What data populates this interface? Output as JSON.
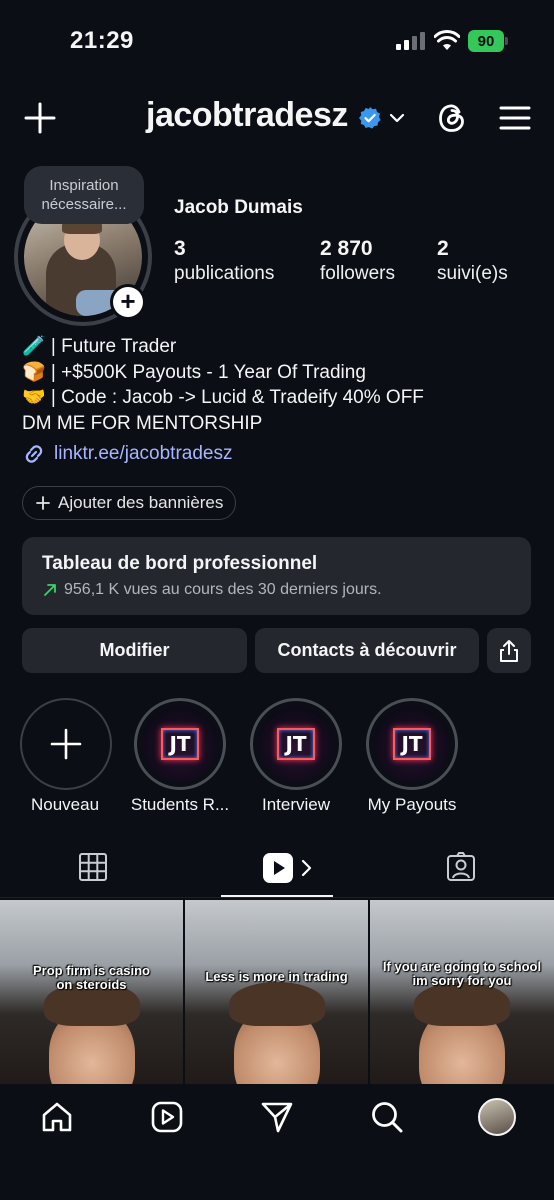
{
  "status": {
    "time": "21:29",
    "battery": "90"
  },
  "header": {
    "username": "jacobtradesz"
  },
  "profile": {
    "note": "Inspiration nécessaire...",
    "full_name": "Jacob Dumais",
    "stats": [
      {
        "value": "3",
        "label": "publications"
      },
      {
        "value": "2 870",
        "label": "followers"
      },
      {
        "value": "2",
        "label": "suivi(e)s"
      }
    ],
    "bio": [
      "🧪 | Future Trader",
      "🍞 | +$500K Payouts - 1 Year Of Trading",
      "🤝 | Code : Jacob -> Lucid & Tradeify 40% OFF",
      "DM ME FOR MENTORSHIP"
    ],
    "link": "linktr.ee/jacobtradesz",
    "banner_button": "Ajouter des bannières"
  },
  "dashboard": {
    "title": "Tableau de bord professionnel",
    "subtitle": "956,1 K vues au cours des 30 derniers jours."
  },
  "actions": {
    "edit": "Modifier",
    "discover": "Contacts à découvrir"
  },
  "highlights": [
    {
      "label": "Nouveau"
    },
    {
      "label": "Students R...",
      "mark": "JT"
    },
    {
      "label": "Interview",
      "mark": "JT"
    },
    {
      "label": "My Payouts",
      "mark": "JT"
    }
  ],
  "posts": [
    {
      "caption": "Prop firm is casino on steroids"
    },
    {
      "caption": "Less is more in trading"
    },
    {
      "caption": "If you are going to school im sorry for you"
    }
  ],
  "colors": {
    "accent_link": "#a7b6ff",
    "verified": "#3897f0",
    "battery": "#34c759",
    "background": "#0b0e14",
    "card": "#24272e"
  }
}
